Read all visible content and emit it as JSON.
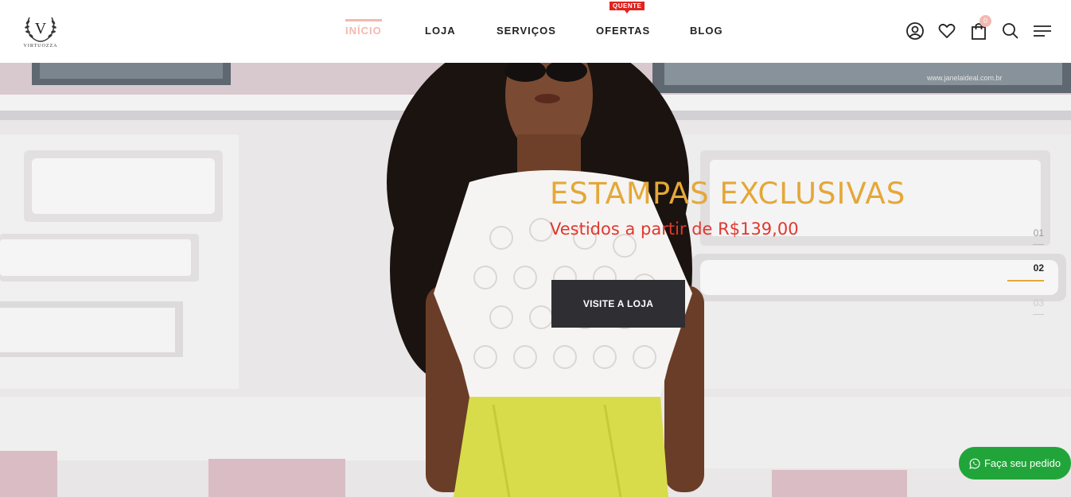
{
  "brand": {
    "logo_letter": "V",
    "logo_text": "VIRTUOZZA"
  },
  "nav": {
    "items": [
      {
        "label": "INÍCIO",
        "active": true
      },
      {
        "label": "LOJA",
        "active": false
      },
      {
        "label": "SERVIÇOS",
        "active": false
      },
      {
        "label": "OFERTAS",
        "active": false,
        "badge": "QUENTE"
      },
      {
        "label": "BLOG",
        "active": false
      }
    ]
  },
  "header_icons": [
    "user-icon",
    "heart-icon",
    "shopping-bag-icon",
    "search-icon",
    "menu-icon"
  ],
  "cart": {
    "count": "0"
  },
  "hero": {
    "title": "ESTAMPAS EXCLUSIVAS",
    "subtitle": "Vestidos a partir de R$139,00",
    "cta_label": "VISITE A LOJA",
    "watermark": "www.janelaideal.com.br",
    "slides": [
      "01",
      "02",
      "03"
    ],
    "active_slide": "02"
  },
  "whatsapp": {
    "label": "Faça seu pedido",
    "icon": "whatsapp-icon"
  },
  "colors": {
    "accent_pink": "#f2b8b0",
    "title_gold": "#e4a838",
    "subtitle_red": "#e0382e",
    "cta_dark": "#2e2e33",
    "whatsapp_green": "#21a53a",
    "badge_red": "#e0231d"
  }
}
